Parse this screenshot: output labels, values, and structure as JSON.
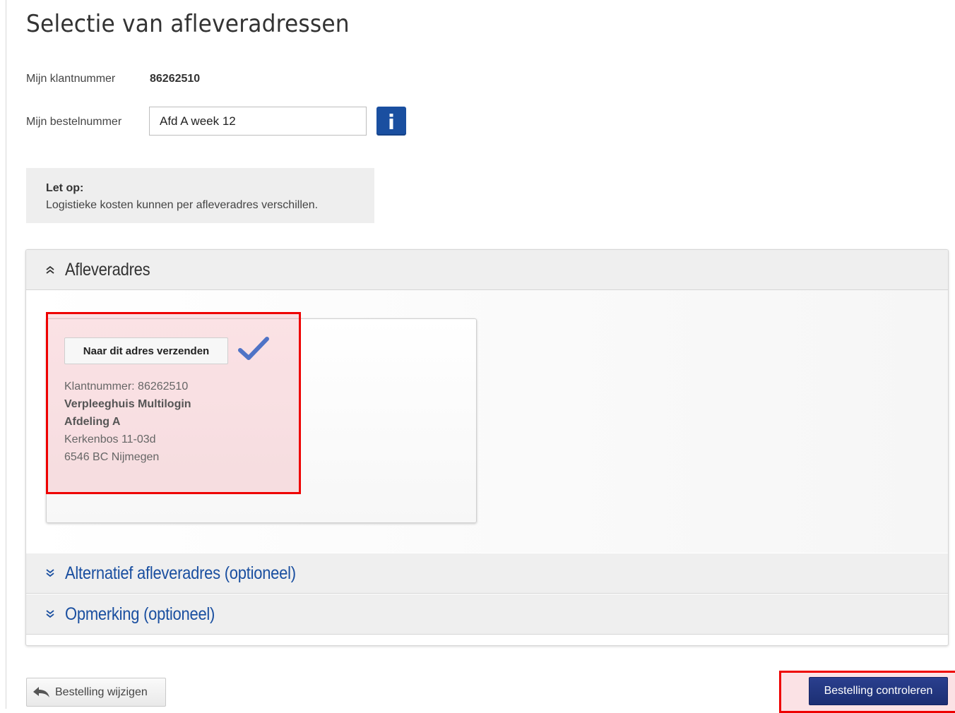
{
  "page": {
    "title": "Selectie van afleveradressen"
  },
  "customer": {
    "label": "Mijn klantnummer",
    "value": "86262510"
  },
  "order": {
    "label": "Mijn bestelnummer",
    "value": "Afd A week 12",
    "info_icon": "info-icon"
  },
  "notice": {
    "heading": "Let op:",
    "text": "Logistieke kosten kunnen per afleveradres verschillen."
  },
  "accordion": {
    "delivery": {
      "title": "Afleveradres",
      "icon": "chevron-double-up-icon",
      "address_card": {
        "select_label": "Naar dit adres verzenden",
        "selected_icon": "checkmark-icon",
        "customer_number": "Klantnummer: 86262510",
        "name": "Verpleeghuis Multilogin",
        "department": "Afdeling A",
        "street": "Kerkenbos 11-03d",
        "city": "6546 BC Nijmegen"
      }
    },
    "alternative": {
      "title": "Alternatief afleveradres (optioneel)",
      "icon": "chevron-double-down-icon"
    },
    "remark": {
      "title": "Opmerking (optioneel)",
      "icon": "chevron-double-down-icon"
    }
  },
  "footer": {
    "back_label": "Bestelling wijzigen",
    "back_icon": "back-arrow-icon",
    "check_label": "Bestelling controleren"
  },
  "colors": {
    "link_blue": "#1a4fa0",
    "primary_button": "#233a84",
    "highlight": "#ee0000"
  }
}
